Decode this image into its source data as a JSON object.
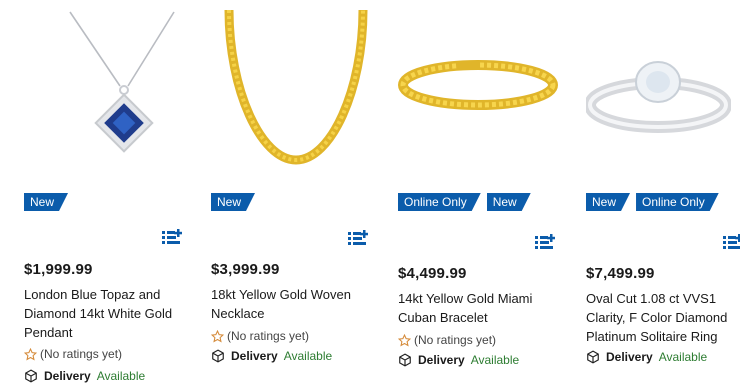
{
  "colors": {
    "badge": "#0b5cab",
    "available": "#2e7d32",
    "price": "#1a1a1a"
  },
  "products": [
    {
      "badges": [
        "New"
      ],
      "price": "$1,999.99",
      "title": "London Blue Topaz and Diamond 14kt White Gold Pendant",
      "rating": "(No ratings yet)",
      "delivery_label": "Delivery",
      "delivery_status": "Available",
      "image": "pendant-necklace"
    },
    {
      "badges": [
        "New"
      ],
      "price": "$3,999.99",
      "title": "18kt Yellow Gold Woven Necklace",
      "rating": "(No ratings yet)",
      "delivery_label": "Delivery",
      "delivery_status": "Available",
      "image": "gold-chain-necklace"
    },
    {
      "badges": [
        "Online Only",
        "New"
      ],
      "price": "$4,499.99",
      "title": "14kt Yellow Gold Miami Cuban Bracelet",
      "rating": "(No ratings yet)",
      "delivery_label": "Delivery",
      "delivery_status": "Available",
      "image": "gold-bracelet"
    },
    {
      "badges": [
        "New",
        "Online Only"
      ],
      "price": "$7,499.99",
      "title": "Oval Cut 1.08 ct VVS1 Clarity, F Color Diamond Platinum Solitaire Ring",
      "delivery_label": "Delivery",
      "delivery_status": "Available",
      "image": "diamond-ring"
    }
  ]
}
